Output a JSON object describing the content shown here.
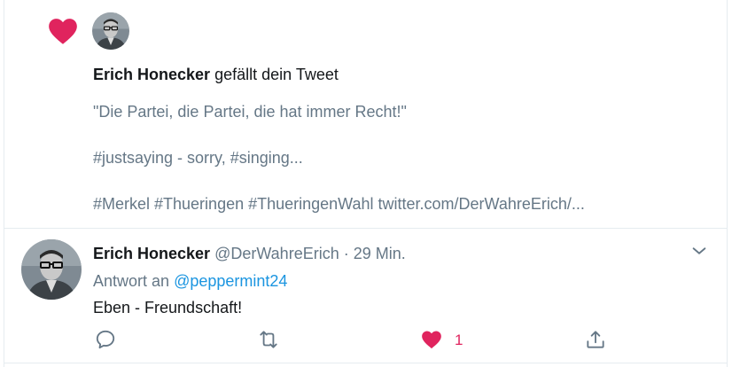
{
  "colors": {
    "like_red": "#e0245e",
    "link_blue": "#1b95e0",
    "secondary_text": "#657786",
    "primary_text": "#14171a",
    "divider": "#e6ecf0"
  },
  "notification": {
    "icon": "heart-icon",
    "user_name": "Erich Honecker",
    "action_text": "gefällt dein Tweet",
    "tweet_lines": [
      "\"Die Partei, die Partei, die hat immer Recht!\"",
      "#justsaying - sorry, #singing...",
      "#Merkel #Thueringen #ThueringenWahl twitter.com/DerWahreErich/..."
    ]
  },
  "reply": {
    "user_name": "Erich Honecker",
    "handle": "@DerWahreErich",
    "separator": "·",
    "time": "29 Min.",
    "reply_to_label": "Antwort an",
    "reply_to_user": "@peppermint24",
    "text": "Eben - Freundschaft!",
    "actions": {
      "reply_icon": "reply-icon",
      "retweet_icon": "retweet-icon",
      "like_icon": "heart-icon",
      "like_count": "1",
      "share_icon": "share-icon",
      "menu_icon": "chevron-down-icon"
    }
  }
}
